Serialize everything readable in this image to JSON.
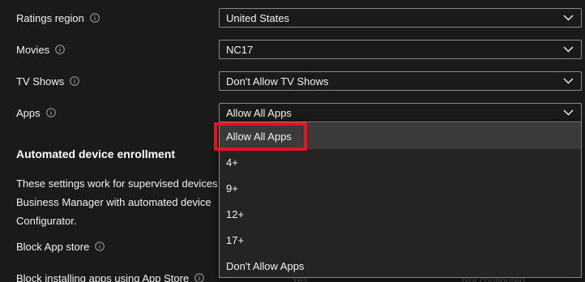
{
  "settings": [
    {
      "label": "Ratings region",
      "value": "United States"
    },
    {
      "label": "Movies",
      "value": "NC17"
    },
    {
      "label": "TV Shows",
      "value": "Don't Allow TV Shows"
    },
    {
      "label": "Apps",
      "value": "Allow All Apps"
    }
  ],
  "section": {
    "title": "Automated device enrollment",
    "description_lines": [
      "These settings work for supervised devices",
      "Business Manager with automated device",
      "Configurator."
    ]
  },
  "lower_settings": [
    {
      "label": "Block App store"
    },
    {
      "label": "Block installing apps using App Store"
    }
  ],
  "background_faded": {
    "left": "Yes",
    "right": "Not configured"
  },
  "dropdown": {
    "options": [
      "Allow All Apps",
      "4+",
      "9+",
      "12+",
      "17+",
      "Don't Allow Apps"
    ],
    "selected": "Allow All Apps"
  },
  "colors": {
    "background": "#1b1a19",
    "dropdown_bg": "#252423",
    "selected_bg": "#3b3a39",
    "highlight": "#e81123",
    "border": "#8a8886"
  }
}
